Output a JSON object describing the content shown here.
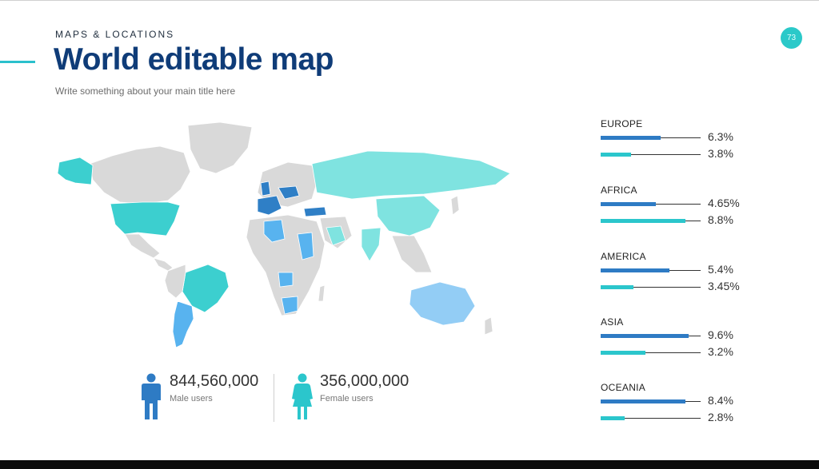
{
  "header": {
    "kicker": "MAPS & LOCATIONS",
    "title": "World editable map",
    "subtitle": "Write something about your main title here",
    "page_number": "73"
  },
  "stats": {
    "male": {
      "value": "844,560,000",
      "label": "Male users",
      "icon": "male-person-icon"
    },
    "female": {
      "value": "356,000,000",
      "label": "Female users",
      "icon": "female-person-icon"
    }
  },
  "regions": [
    {
      "name": "EUROPE",
      "bars": [
        {
          "value": "6.3%",
          "level": 0.6
        },
        {
          "value": "3.8%",
          "level": 0.3
        }
      ]
    },
    {
      "name": "AFRICA",
      "bars": [
        {
          "value": "4.65%",
          "level": 0.55
        },
        {
          "value": "8.8%",
          "level": 0.85
        }
      ]
    },
    {
      "name": "AMERICA",
      "bars": [
        {
          "value": "5.4%",
          "level": 0.69
        },
        {
          "value": "3.45%",
          "level": 0.33
        }
      ]
    },
    {
      "name": "ASIA",
      "bars": [
        {
          "value": "9.6%",
          "level": 0.88
        },
        {
          "value": "3.2%",
          "level": 0.45
        }
      ]
    },
    {
      "name": "OCEANIA",
      "bars": [
        {
          "value": "8.4%",
          "level": 0.85
        },
        {
          "value": "2.8%",
          "level": 0.24
        }
      ]
    }
  ],
  "colors": {
    "title": "#0f3c78",
    "bar_primary": "#2e7bc4",
    "bar_secondary": "#2bc6cc",
    "map_base": "#d9d9d9",
    "map_teal": "#3ccfcf",
    "map_light_teal": "#7fe3e0",
    "map_blue": "#2f7fc6",
    "map_light_blue": "#58b3ef",
    "map_pale_blue": "#93cdf5"
  }
}
